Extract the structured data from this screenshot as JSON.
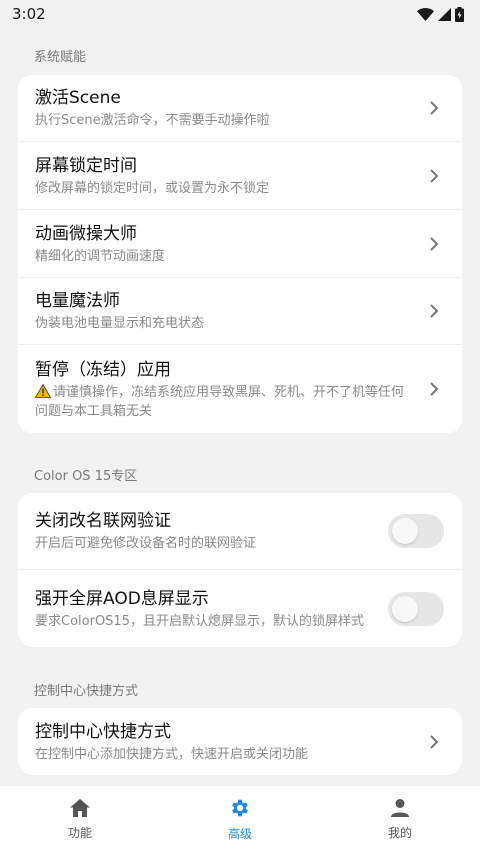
{
  "status": {
    "time": "3:02"
  },
  "sections": [
    {
      "title": "系统赋能",
      "items": [
        {
          "title": "激活Scene",
          "subtitle": "执行Scene激活命令，不需要手动操作啦"
        },
        {
          "title": "屏幕锁定时间",
          "subtitle": "修改屏幕的锁定时间，或设置为永不锁定"
        },
        {
          "title": "动画微操大师",
          "subtitle": "精细化的调节动画速度"
        },
        {
          "title": "电量魔法师",
          "subtitle": "伪装电池电量显示和充电状态"
        },
        {
          "title": "暂停（冻结）应用",
          "subtitle": "请谨慎操作，冻结系统应用导致黑屏、死机、开不了机等任何问题与本工具箱无关"
        }
      ]
    },
    {
      "title": "Color OS 15专区",
      "items": [
        {
          "title": "关闭改名联网验证",
          "subtitle": "开启后可避免修改设备名时的联网验证",
          "toggle": false
        },
        {
          "title": "强开全屏AOD息屏显示",
          "subtitle": "要求ColorOS15，且开启默认熄屏显示，默认的锁屏样式",
          "toggle": false
        }
      ]
    },
    {
      "title": "控制中心快捷方式",
      "items": [
        {
          "title": "控制中心快捷方式",
          "subtitle": "在控制中心添加快捷方式，快速开启或关闭功能"
        }
      ]
    }
  ],
  "nav": {
    "items": [
      {
        "label": "功能",
        "icon": "home-icon"
      },
      {
        "label": "高级",
        "icon": "gear-icon",
        "active": true
      },
      {
        "label": "我的",
        "icon": "person-icon"
      }
    ]
  },
  "colors": {
    "accent": "#1E88E5",
    "background": "#F2F2F2",
    "card": "#FFFFFF",
    "warning": "#F2B705"
  }
}
